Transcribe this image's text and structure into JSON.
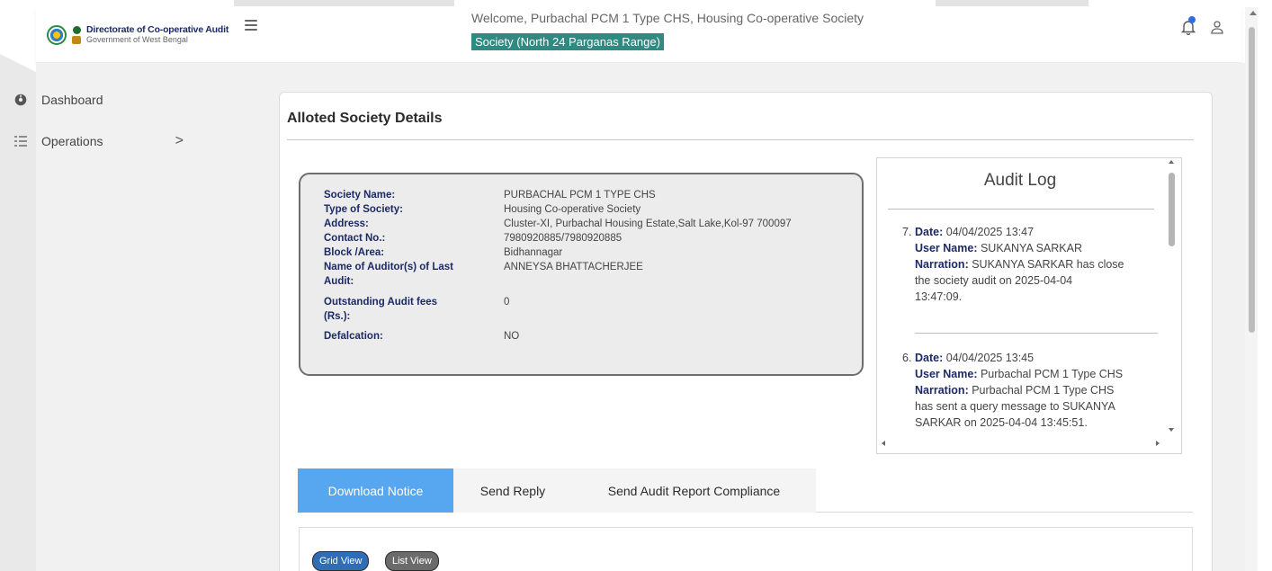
{
  "header": {
    "brand_title": "Directorate of Co-operative Audit",
    "brand_subtitle": "Government of West Bengal",
    "welcome_text": "Welcome,  Purbachal PCM 1 Type CHS,  Housing Co-operative Society",
    "range_text": "Society (North 24 Parganas Range)"
  },
  "sidebar": {
    "items": [
      {
        "label": "Dashboard",
        "icon": "dashboard-icon"
      },
      {
        "label": "Operations",
        "icon": "list-icon",
        "chevron": ">"
      }
    ]
  },
  "card": {
    "title": "Alloted Society Details",
    "details": [
      {
        "label": "Society Name:",
        "value": "PURBACHAL PCM 1 TYPE CHS"
      },
      {
        "label": "Type of Society:",
        "value": "Housing Co-operative Society"
      },
      {
        "label": "Address:",
        "value": "Cluster-XI, Purbachal Housing Estate,Salt Lake,Kol-97 700097"
      },
      {
        "label": "Contact No.:",
        "value": "7980920885/7980920885"
      },
      {
        "label": "Block /Area:",
        "value": "Bidhannagar"
      },
      {
        "label": "Name of Auditor(s) of Last",
        "label2": "Audit:",
        "value": "ANNEYSA BHATTACHERJEE"
      },
      {
        "label": "Outstanding Audit fees",
        "label2": "(Rs.):",
        "value": "0"
      },
      {
        "label": "Defalcation:",
        "value": "NO"
      }
    ]
  },
  "audit_log": {
    "title": "Audit Log",
    "entries": [
      {
        "num": "7.",
        "date_label": "Date:",
        "date": "04/04/2025 13:47",
        "user_label": "User Name:",
        "user": "SUKANYA SARKAR",
        "narration_label": "Narration:",
        "narration_lines": [
          "SUKANYA SARKAR has close",
          "the society audit on 2025-04-04",
          "13:47:09."
        ]
      },
      {
        "num": "6.",
        "date_label": "Date:",
        "date": "04/04/2025 13:45",
        "user_label": "User Name:",
        "user": "Purbachal PCM 1 Type CHS",
        "narration_label": "Narration:",
        "narration_lines": [
          "Purbachal PCM 1 Type CHS",
          "has sent a query message to SUKANYA",
          "SARKAR on 2025-04-04 13:45:51."
        ]
      }
    ]
  },
  "tabs": [
    {
      "label": "Download Notice",
      "active": true
    },
    {
      "label": "Send Reply",
      "active": false
    },
    {
      "label": "Send Audit Report Compliance",
      "active": false
    }
  ],
  "view_buttons": {
    "grid": "Grid View",
    "list": "List View"
  },
  "colors": {
    "brand_navy": "#1b2a68",
    "range_badge": "#2f8b82",
    "active_tab": "#56a6f0",
    "grid_btn": "#2f6db5",
    "list_btn": "#6b6b6b"
  }
}
